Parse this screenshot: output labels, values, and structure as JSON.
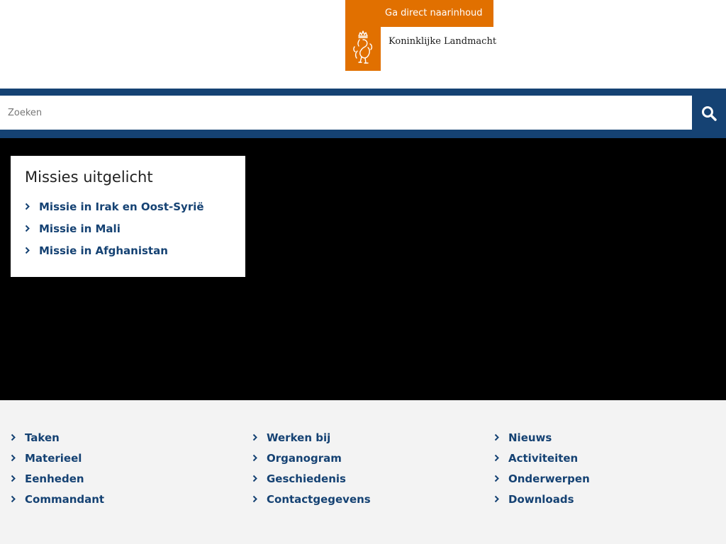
{
  "header": {
    "skip_link": "Ga direct naarinhoud",
    "brand_name": "Koninklijke Landmacht"
  },
  "search": {
    "placeholder": "Zoeken"
  },
  "missions": {
    "title": "Missies uitgelicht",
    "items": [
      {
        "label": "Missie in Irak en Oost-Syrië"
      },
      {
        "label": "Missie in Mali"
      },
      {
        "label": "Missie in Afghanistan"
      }
    ]
  },
  "footer": {
    "col1": [
      {
        "label": "Taken"
      },
      {
        "label": "Materieel"
      },
      {
        "label": "Eenheden"
      },
      {
        "label": "Commandant"
      }
    ],
    "col2": [
      {
        "label": "Werken bij"
      },
      {
        "label": "Organogram"
      },
      {
        "label": "Geschiedenis"
      },
      {
        "label": "Contactgegevens"
      }
    ],
    "col3": [
      {
        "label": "Nieuws"
      },
      {
        "label": "Activiteiten"
      },
      {
        "label": "Onderwerpen"
      },
      {
        "label": "Downloads"
      }
    ]
  },
  "colors": {
    "brand_orange": "#e17000",
    "link_blue": "#154273",
    "band_blue": "#154273",
    "footer_bg": "#f3f3f3"
  },
  "icons": {
    "logo": "coat-of-arms-icon",
    "search": "search-icon",
    "bullet": "chevron-right-icon"
  }
}
